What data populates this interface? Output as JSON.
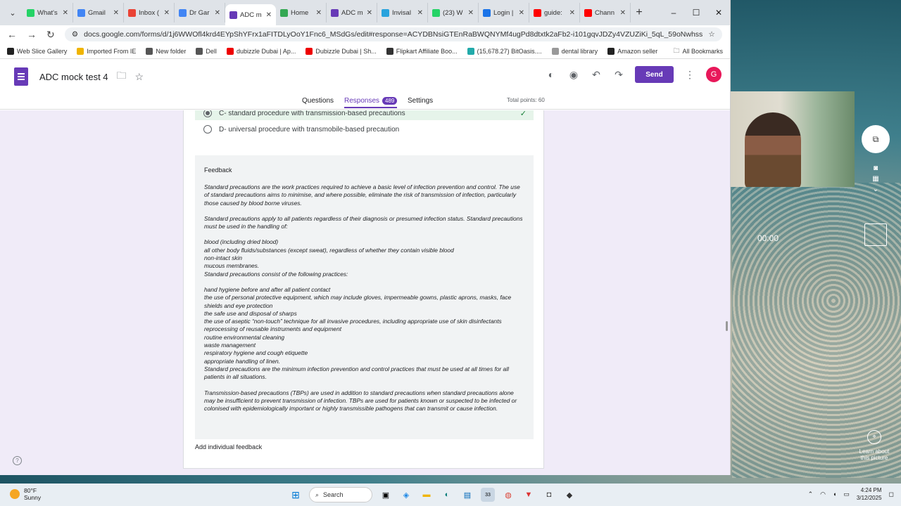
{
  "browser": {
    "tabs": [
      {
        "label": "What's",
        "color": "#25d366"
      },
      {
        "label": "Gmail",
        "color": "#4285f4"
      },
      {
        "label": "Inbox (",
        "color": "#ea4335"
      },
      {
        "label": "Dr Gar",
        "color": "#4285f4"
      },
      {
        "label": "ADC m",
        "color": "#673ab7",
        "active": true
      },
      {
        "label": "Home",
        "color": "#34a853"
      },
      {
        "label": "ADC m",
        "color": "#673ab7"
      },
      {
        "label": "Invisal",
        "color": "#29a3dd"
      },
      {
        "label": "(23) W",
        "color": "#25d366"
      },
      {
        "label": "Login |",
        "color": "#1a73e8"
      },
      {
        "label": "guide:",
        "color": "#ff0000"
      },
      {
        "label": "Chann",
        "color": "#ff0000"
      }
    ],
    "url": "docs.google.com/forms/d/1j6WWOfl4krd4EYpShYFrx1aFITDLyOoY1Fnc6_MSdGs/edit#response=ACYDBNsiGTEnRaBWQNYMf4ugPd8dtxtk2aFb2-i101gqvJDZy4VZUZiKi_5qL_59oNwhss",
    "bookmarks": [
      {
        "label": "Web Slice Gallery",
        "color": "#222"
      },
      {
        "label": "Imported From IE",
        "color": "#f0b400"
      },
      {
        "label": "New folder",
        "color": "#555"
      },
      {
        "label": "Dell",
        "color": "#555"
      },
      {
        "label": "dubizzle Dubai | Ap...",
        "color": "#e00"
      },
      {
        "label": "Dubizzle Dubai | Sh...",
        "color": "#e00"
      },
      {
        "label": "Flipkart Affiliate Boo...",
        "color": "#333"
      },
      {
        "label": "(15,678.27) BitOasis....",
        "color": "#2aa"
      },
      {
        "label": "dental library",
        "color": "#999"
      },
      {
        "label": "Amazon seller",
        "color": "#222"
      }
    ],
    "all_bookmarks": "All Bookmarks"
  },
  "forms": {
    "title": "ADC mock test 4",
    "send": "Send",
    "avatar": "G",
    "nav": {
      "questions": "Questions",
      "responses": "Responses",
      "count": "489",
      "settings": "Settings",
      "total": "Total points: 60"
    }
  },
  "question": {
    "option_c": "C- standard procedure with transmission-based precautions",
    "option_d": "D- universal procedure with transmobile-based precaution"
  },
  "feedback": {
    "heading": "Feedback",
    "p1": "Standard precautions are the work practices required to achieve a basic level of infection prevention and control. The use of standard precautions aims to minimise, and where possible, eliminate the risk of transmission of infection, particularly those caused by blood borne viruses.",
    "p2": "Standard precautions apply to all patients regardless of their diagnosis or presumed infection status. Standard precautions must be used in the handling of:",
    "list1": [
      "blood (including dried blood)",
      "all other body fluids/substances (except sweat), regardless of whether they contain visible blood",
      "non-intact skin",
      "mucous membranes.",
      "Standard precautions consist of the following practices:"
    ],
    "list2": [
      "hand hygiene before and after all patient contact",
      "the use of personal protective equipment, which may include gloves, impermeable gowns, plastic aprons, masks, face shields and eye protection",
      "the safe use and disposal of sharps",
      "the use of aseptic “non-touch” technique for all invasive procedures, including appropriate use of skin disinfectants",
      "reprocessing of reusable instruments and equipment",
      "routine environmental cleaning",
      "waste management",
      "respiratory hygiene and cough etiquette",
      "appropriate handling of linen.",
      "Standard precautions are the minimum infection prevention and control practices that must be used at all times for all patients in all situations."
    ],
    "p3": "Transmission-based precautions (TBPs) are used in addition to standard precautions when standard precautions alone may be insufficient to prevent transmission of infection. TBPs are used for patients known or suspected to be infected or colonised with epidemiologically important or highly transmissible pathogens that can transmit or cause infection.",
    "add": "Add individual feedback"
  },
  "overlay": {
    "timer": "00:00",
    "learn": "Learn about this picture"
  },
  "taskbar": {
    "temp": "80°F",
    "weather": "Sunny",
    "search": "Search",
    "badge": "33",
    "time": "4:24 PM",
    "date": "3/12/2025"
  }
}
